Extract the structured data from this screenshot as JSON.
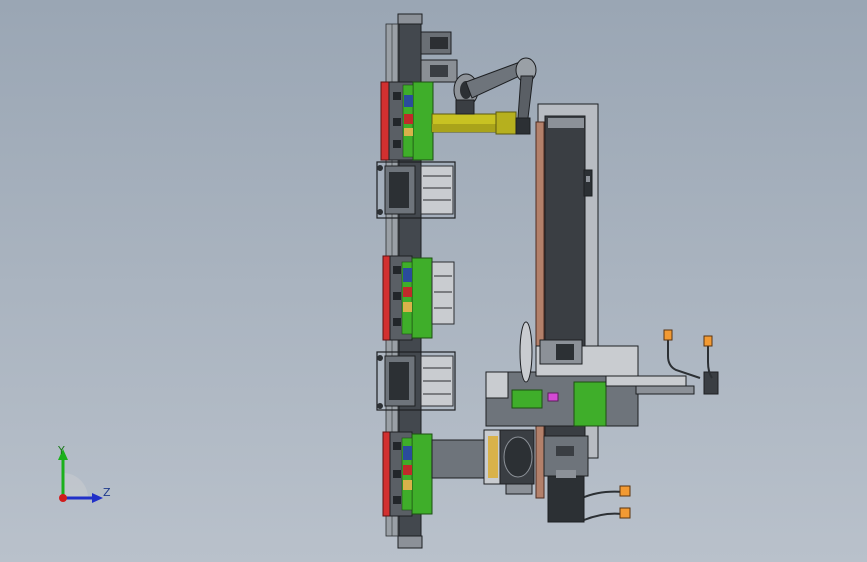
{
  "view": {
    "background_top": "#9aa6b4",
    "background_bottom": "#b9c1cb"
  },
  "triad": {
    "y_label": "Y",
    "z_label": "Z",
    "y_color": "#1bb01b",
    "z_color": "#2130c8",
    "origin_color": "#d01c1c"
  },
  "palette": {
    "frame_dark": "#3d4146",
    "frame_mid": "#6e747b",
    "frame_light": "#c9ccd0",
    "module_green": "#3fae2a",
    "rail_red": "#d23030",
    "arm_yellow": "#c8c222",
    "column_panel": "#b8bcc2",
    "slide_copper": "#b3806a",
    "accent_magenta": "#d44ad4",
    "cable_orange": "#f29a33"
  }
}
